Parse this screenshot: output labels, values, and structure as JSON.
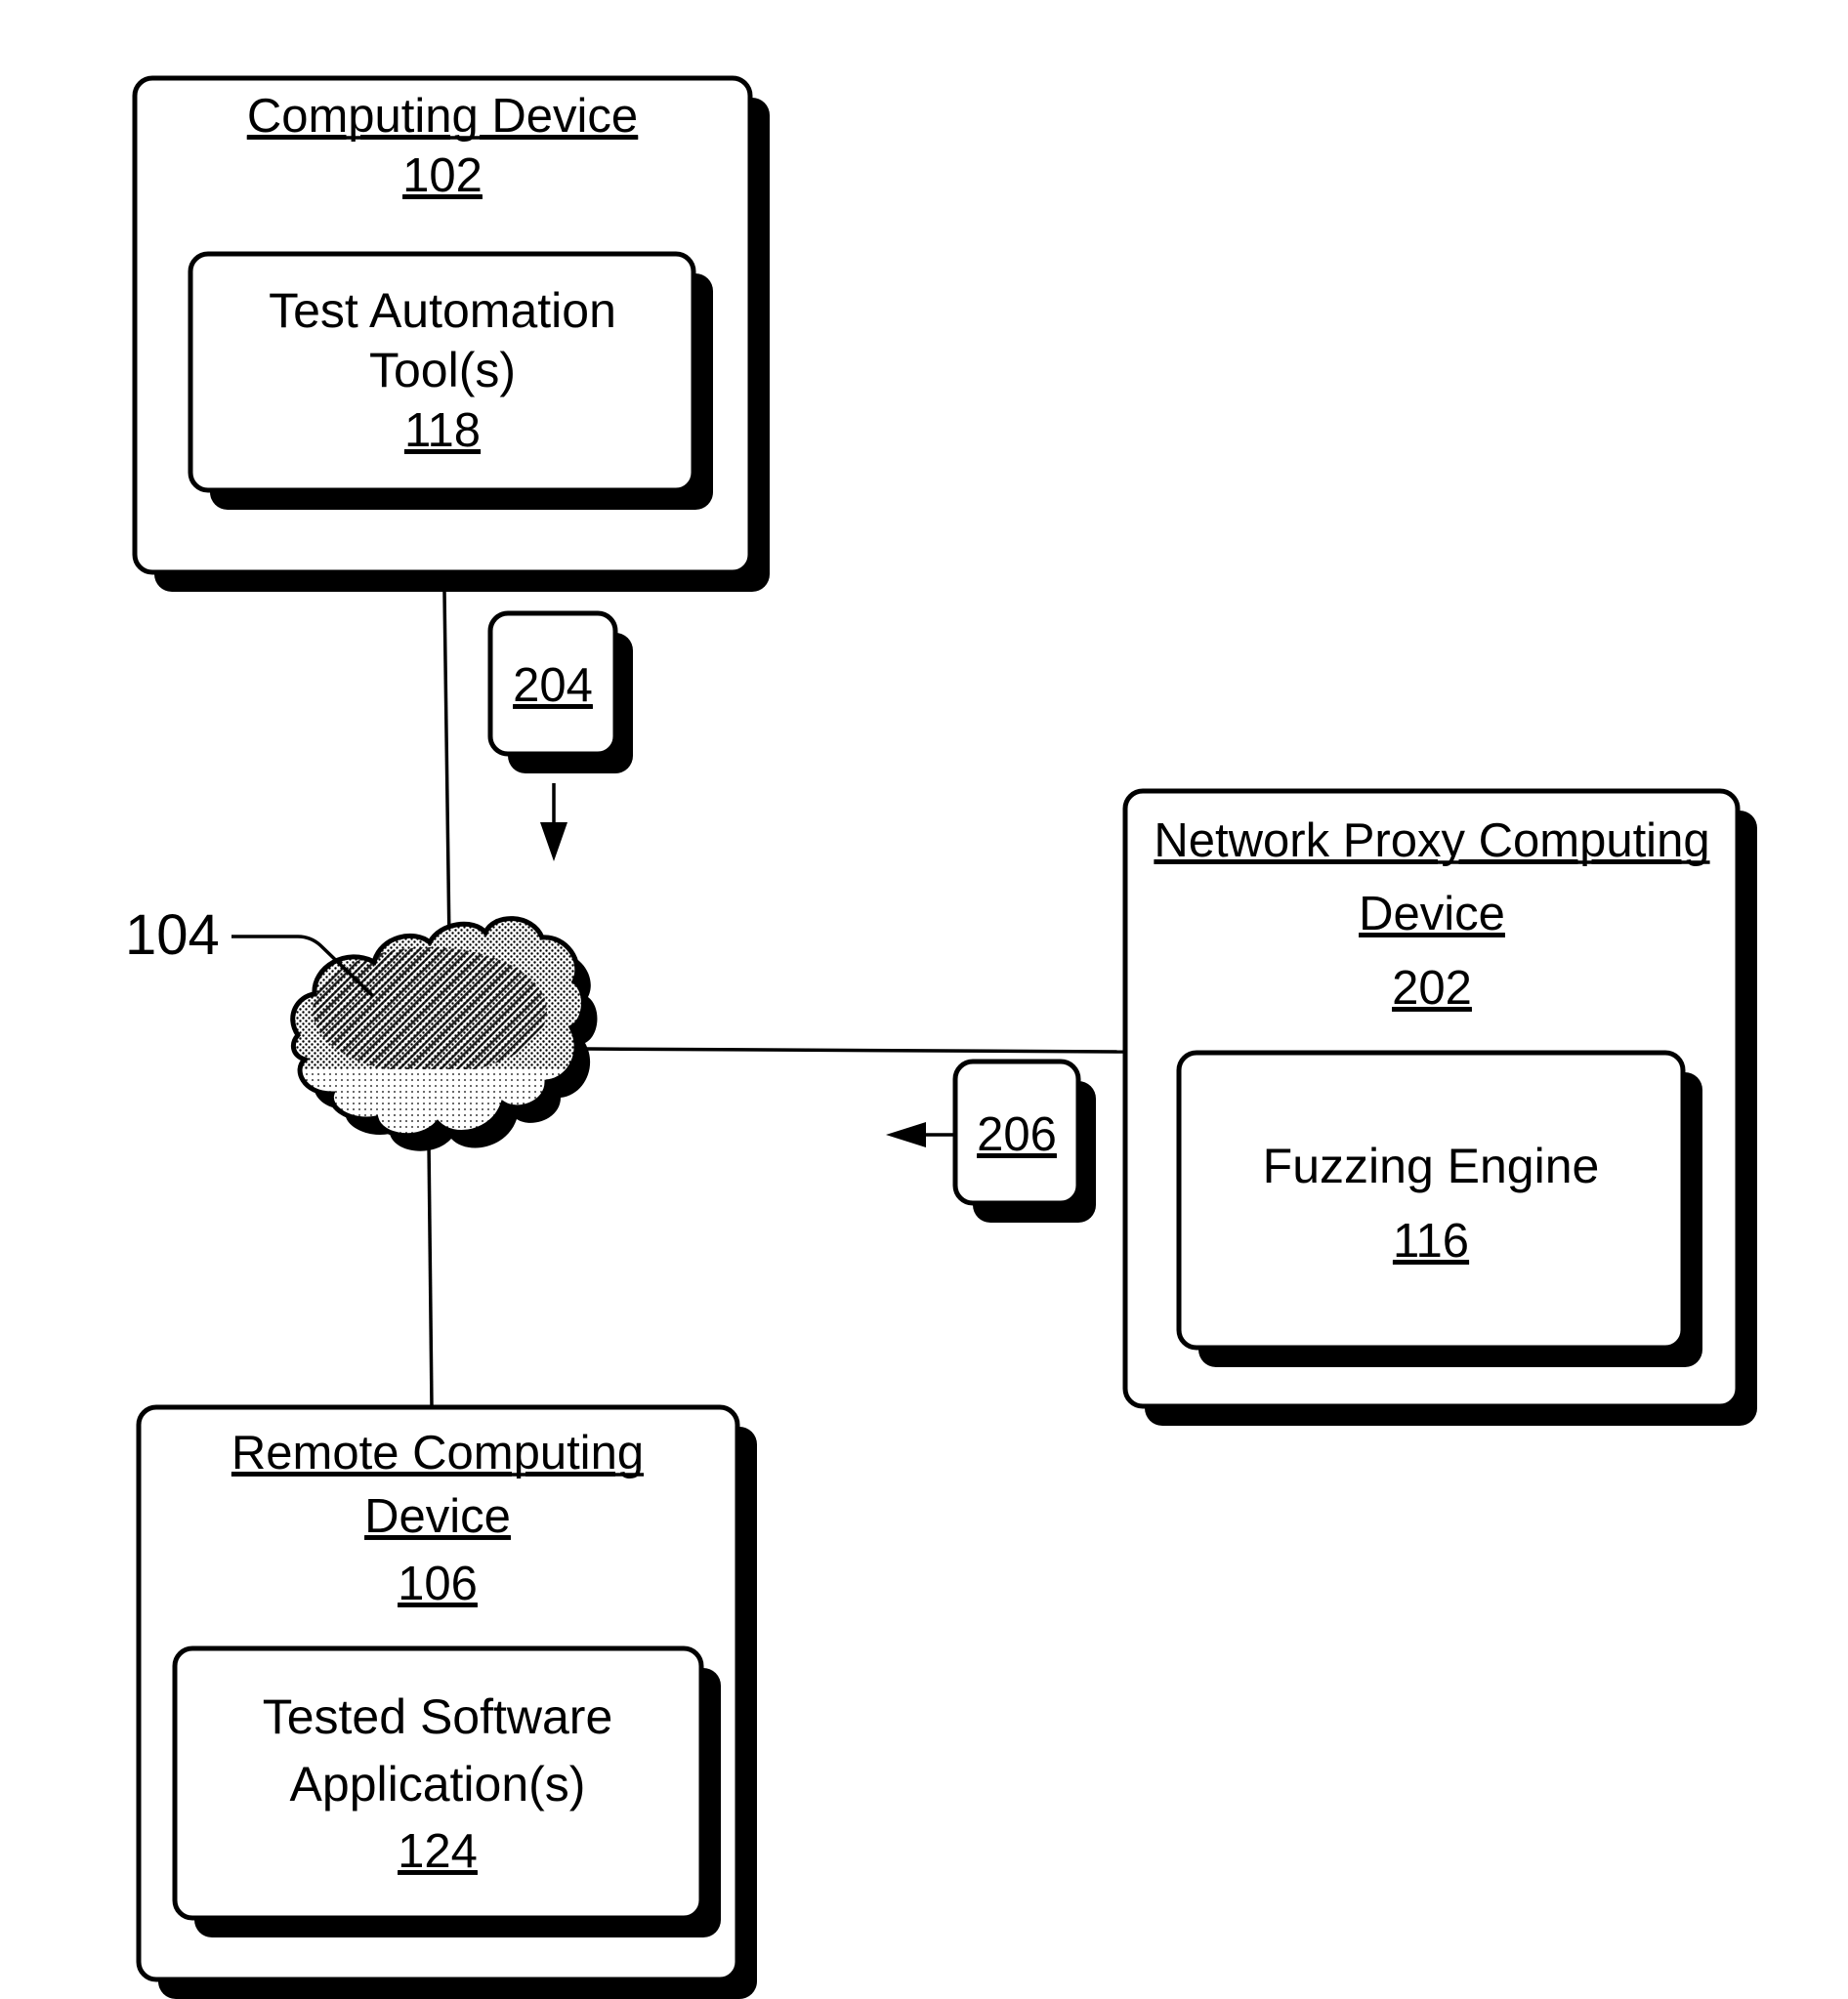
{
  "figure": {
    "nodes": {
      "computing_device": {
        "title_lines": [
          "Computing Device"
        ],
        "ref": "102",
        "component": {
          "lines": [
            "Test Automation",
            "Tool(s)"
          ],
          "ref": "118"
        }
      },
      "network_proxy": {
        "title_lines": [
          "Network Proxy Computing",
          "Device"
        ],
        "ref": "202",
        "component": {
          "lines": [
            "Fuzzing Engine"
          ],
          "ref": "116"
        }
      },
      "remote_device": {
        "title_lines": [
          "Remote Computing",
          "Device"
        ],
        "ref": "106",
        "component": {
          "lines": [
            "Tested Software",
            "Application(s)"
          ],
          "ref": "124"
        }
      },
      "network": {
        "ref": "104",
        "shape": "cloud-icon"
      }
    },
    "flows": [
      {
        "ref": "204",
        "direction": "down",
        "description": "from computing device toward network"
      },
      {
        "ref": "206",
        "direction": "left",
        "description": "from network proxy toward network"
      }
    ],
    "colors": {
      "stroke": "#000000",
      "background": "#ffffff",
      "shadow": "#000000"
    }
  }
}
